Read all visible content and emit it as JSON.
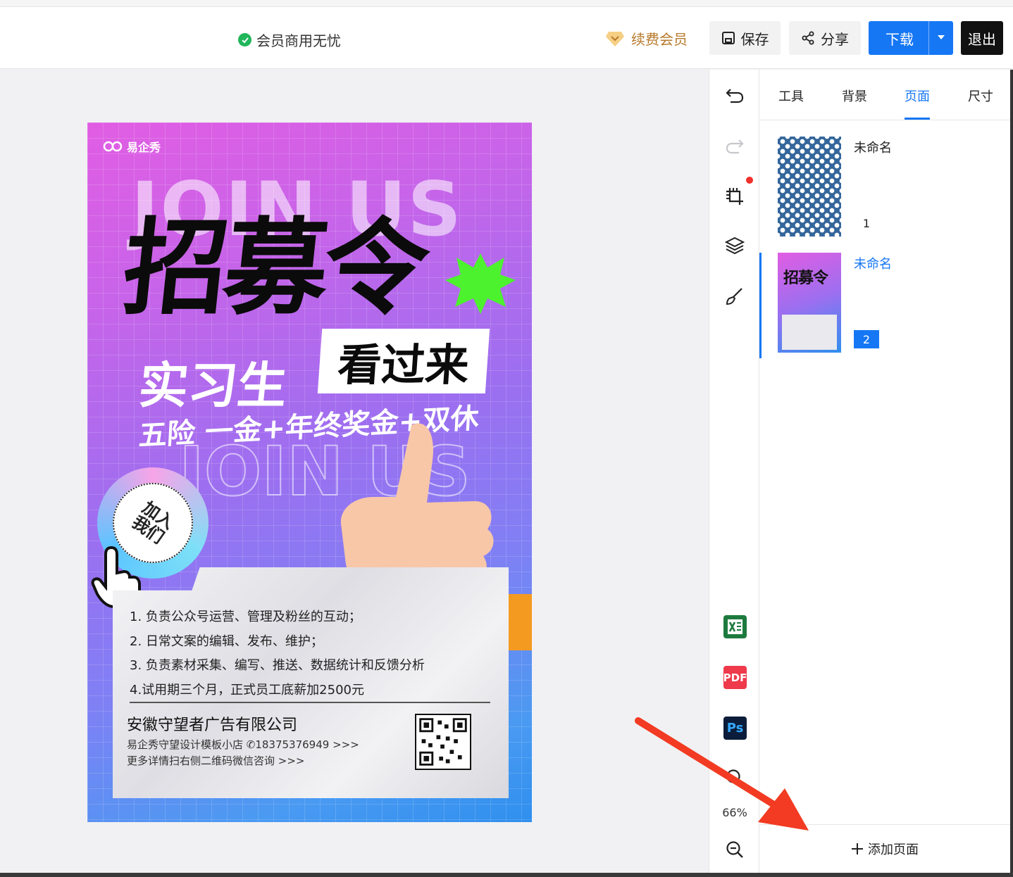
{
  "header": {
    "commercial_text": "会员商用无忧",
    "renew_label": "续费会员",
    "save_label": "保存",
    "share_label": "分享",
    "download_label": "下载",
    "exit_label": "退出"
  },
  "poster": {
    "logo_text": "易企秀",
    "join_us": "JOIN US",
    "title": "招募令",
    "subtitle_left": "实习生",
    "subtitle_box": "看过来",
    "benefits": "五险 一金+年终奖金+双休",
    "badge_line1": "加入",
    "badge_line2": "我们",
    "duties": [
      "1. 负责公众号运营、管理及粉丝的互动；",
      "2. 日常文案的编辑、发布、维护；",
      "3. 负责素材采集、编写、推送、数据统计和反馈分析",
      "4.试用期三个月，正式员工底薪加2500元"
    ],
    "company": "安徽守望者广告有限公司",
    "shop_line": "易企秀守望设计模板小店  ✆18375376949 >>>",
    "more_line": "更多详情扫右侧二维码微信咨询 >>>"
  },
  "toolbar": {
    "zoom_level": "66%",
    "icons": [
      "undo-icon",
      "redo-icon",
      "crop-icon",
      "layers-icon",
      "brush-icon",
      "excel-icon",
      "pdf-icon",
      "ps-icon",
      "zoom-in-icon",
      "zoom-out-icon"
    ],
    "pdf_label": "PDF",
    "ps_label": "Ps"
  },
  "panel": {
    "tabs": [
      {
        "label": "工具"
      },
      {
        "label": "背景"
      },
      {
        "label": "页面"
      },
      {
        "label": "尺寸"
      }
    ],
    "active_tab": "页面",
    "pages": [
      {
        "name": "未命名",
        "number": "1"
      },
      {
        "name": "未命名",
        "number": "2"
      }
    ],
    "add_page_label": "添加页面"
  },
  "colors": {
    "accent": "#1677f5",
    "exit_bg": "#111111",
    "renew_text": "#b7792a",
    "check_green": "#20b65a",
    "annotation_arrow": "#f23b22"
  }
}
